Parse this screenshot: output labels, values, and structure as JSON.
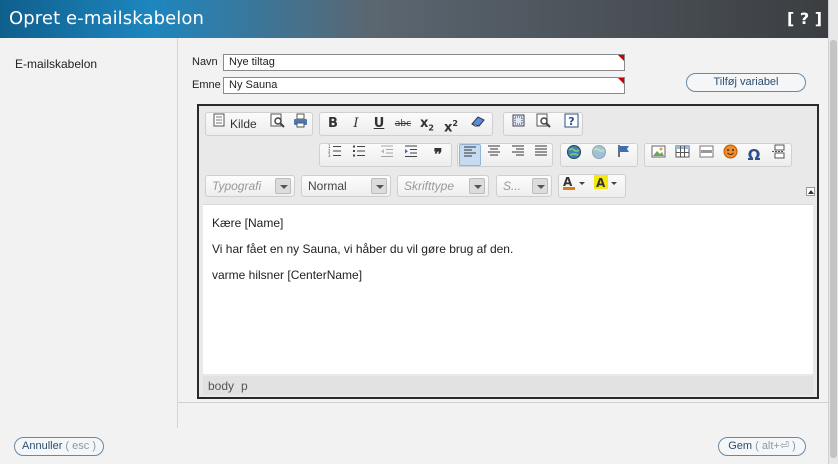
{
  "header": {
    "title": "Opret e-mailskabelon",
    "help": "[ ? ]"
  },
  "sidebar": {
    "label": "E-mailskabelon"
  },
  "form": {
    "name_label": "Navn",
    "name_value": "Nye tiltag",
    "subject_label": "Emne",
    "subject_value": "Ny Sauna",
    "add_variable": "Tilføj variabel"
  },
  "editor": {
    "toolbar": {
      "source_label": "Kilde",
      "font_format_placeholder": "Typografi",
      "format_value": "Normal",
      "font_family_placeholder": "Skrifttype",
      "font_size_placeholder": "S...",
      "icons": [
        "source-icon",
        "preview-icon",
        "print-icon",
        "bold-icon",
        "italic-icon",
        "underline-icon",
        "strikethrough-icon",
        "subscript-icon",
        "superscript-icon",
        "remove-format-icon",
        "show-blocks-icon",
        "find-icon",
        "about-icon",
        "numbered-list-icon",
        "bulleted-list-icon",
        "outdent-icon",
        "indent-icon",
        "blockquote-icon",
        "align-left-icon",
        "align-center-icon",
        "align-right-icon",
        "justify-icon",
        "link-icon",
        "unlink-icon",
        "anchor-icon",
        "image-icon",
        "table-icon",
        "horizontal-rule-icon",
        "smiley-icon",
        "special-char-icon",
        "page-break-icon",
        "text-color-icon",
        "bg-color-icon"
      ]
    },
    "content": {
      "line1": "Kære [Name]",
      "line2": "Vi har fået en ny Sauna, vi håber du vil gøre brug af den.",
      "line3": "varme hilsner [CenterName]"
    },
    "status": {
      "path1": "body",
      "path2": "p"
    }
  },
  "footer": {
    "cancel_label": "Annuller",
    "cancel_shortcut": "( esc )",
    "save_label": "Gem",
    "save_shortcut": "( alt+⏎ )"
  },
  "colors": {
    "header_start": "#0f5f8c",
    "header_end": "#3b3e41",
    "pill_border": "#6e87a1",
    "required_marker": "#cc0000"
  }
}
